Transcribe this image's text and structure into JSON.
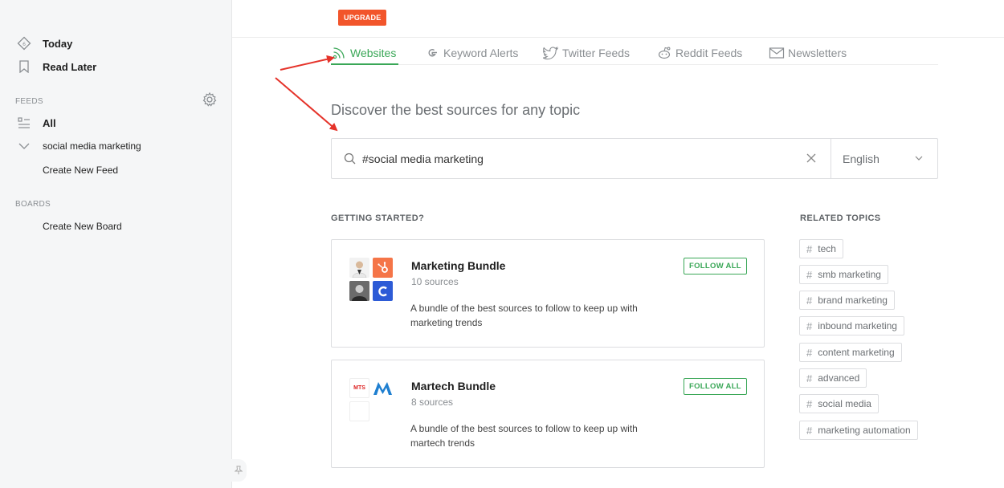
{
  "sidebar": {
    "nav": [
      {
        "label": "Today",
        "icon": "today-icon"
      },
      {
        "label": "Read Later",
        "icon": "bookmark-icon"
      }
    ],
    "feeds_title": "FEEDS",
    "feeds": [
      {
        "label": "All",
        "icon": "list-icon"
      },
      {
        "label": "social media marketing",
        "icon": "chevron-down-icon"
      }
    ],
    "create_feed": "Create New Feed",
    "boards_title": "BOARDS",
    "create_board": "Create New Board"
  },
  "topbar": {
    "upgrade_label": "UPGRADE"
  },
  "tabs": [
    {
      "label": "Websites",
      "icon": "rss-icon",
      "active": true
    },
    {
      "label": "Keyword Alerts",
      "icon": "google-icon",
      "active": false
    },
    {
      "label": "Twitter Feeds",
      "icon": "twitter-icon",
      "active": false
    },
    {
      "label": "Reddit Feeds",
      "icon": "reddit-icon",
      "active": false
    },
    {
      "label": "Newsletters",
      "icon": "mail-icon",
      "active": false
    }
  ],
  "discover_heading": "Discover the best sources for any topic",
  "search": {
    "value": "#social media marketing",
    "language": "English"
  },
  "getting_started_title": "GETTING STARTED?",
  "bundles": [
    {
      "title": "Marketing Bundle",
      "count": "10 sources",
      "description": "A bundle of the best sources to follow to keep up with marketing trends",
      "follow_label": "FOLLOW ALL"
    },
    {
      "title": "Martech Bundle",
      "count": "8 sources",
      "description": "A bundle of the best sources to follow to keep up with martech trends",
      "follow_label": "FOLLOW ALL"
    }
  ],
  "related_title": "RELATED TOPICS",
  "related_topics": [
    "tech",
    "smb marketing",
    "brand marketing",
    "inbound marketing",
    "content marketing",
    "advanced",
    "social media",
    "marketing automation"
  ],
  "thumb_labels": {
    "martech_logo_text": "MTS"
  },
  "colors": {
    "accent": "#3aa757",
    "upgrade": "#f2552b",
    "arrow": "#e5332a",
    "hubspot": "#f57548",
    "c_logo": "#2d5bd6",
    "m_logo": "#1f7fd0"
  }
}
